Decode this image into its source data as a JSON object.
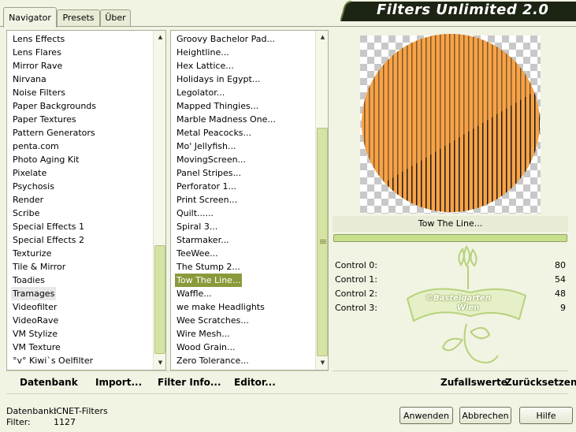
{
  "tabs": [
    {
      "label": "Navigator",
      "active": true
    },
    {
      "label": "Presets",
      "active": false
    },
    {
      "label": "Über",
      "active": false
    }
  ],
  "header": {
    "title": "Filters Unlimited 2.0"
  },
  "categories": {
    "items": [
      "Lens Effects",
      "Lens Flares",
      "Mirror Rave",
      "Nirvana",
      "Noise Filters",
      "Paper Backgrounds",
      "Paper Textures",
      "Pattern Generators",
      "penta.com",
      "Photo Aging Kit",
      "Pixelate",
      "Psychosis",
      "Render",
      "Scribe",
      "Special Effects 1",
      "Special Effects 2",
      "Texturize",
      "Tile & Mirror",
      "Toadies",
      "Tramages",
      "Videofilter",
      "VideoRave",
      "VM Stylize",
      "VM Texture",
      "°v° Kiwi`s Oelfilter"
    ],
    "selected": "Tramages"
  },
  "filters": {
    "items": [
      "Groovy Bachelor Pad...",
      "Heightline...",
      "Hex Lattice...",
      "Holidays in Egypt...",
      "Legolator...",
      "Mapped Thingies...",
      "Marble Madness One...",
      "Metal Peacocks...",
      "Mo' Jellyfish...",
      "MovingScreen...",
      "Panel Stripes...",
      "Perforator 1...",
      "Print Screen...",
      "Quilt......",
      "Spiral 3...",
      "Starmaker...",
      "TeeWee...",
      "The Stump 2...",
      "Tow The Line...",
      "Waffle...",
      "we make Headlights",
      "Wee Scratches...",
      "Wire Mesh...",
      "Wood Grain...",
      "Zero Tolerance..."
    ],
    "selected": "Tow The Line..."
  },
  "toolbar": {
    "datenbank": "Datenbank",
    "import": "Import...",
    "filter_info": "Filter Info...",
    "editor": "Editor...",
    "zufallswerte": "Zufallswerte",
    "zuruecksetzen": "Zurücksetzen"
  },
  "preview": {
    "filter_name": "Tow The Line..."
  },
  "controls": [
    {
      "label": "Control 0:",
      "value": "80"
    },
    {
      "label": "Control 1:",
      "value": "54"
    },
    {
      "label": "Control 2:",
      "value": "48"
    },
    {
      "label": "Control 3:",
      "value": "9"
    }
  ],
  "watermark": {
    "line1": "©Bastelgarten",
    "line2": "Wien"
  },
  "status": {
    "datenbank_label": "Datenbank:",
    "datenbank_value": "ICNET-Filters",
    "filter_label": "Filter:",
    "filter_value": "1127"
  },
  "buttons": {
    "apply": "Anwenden",
    "cancel": "Abbrechen",
    "help": "Hilfe"
  },
  "colors": {
    "accent": "#8a9a3a",
    "orange": "#f8a347",
    "bg": "#f1f3e3"
  }
}
